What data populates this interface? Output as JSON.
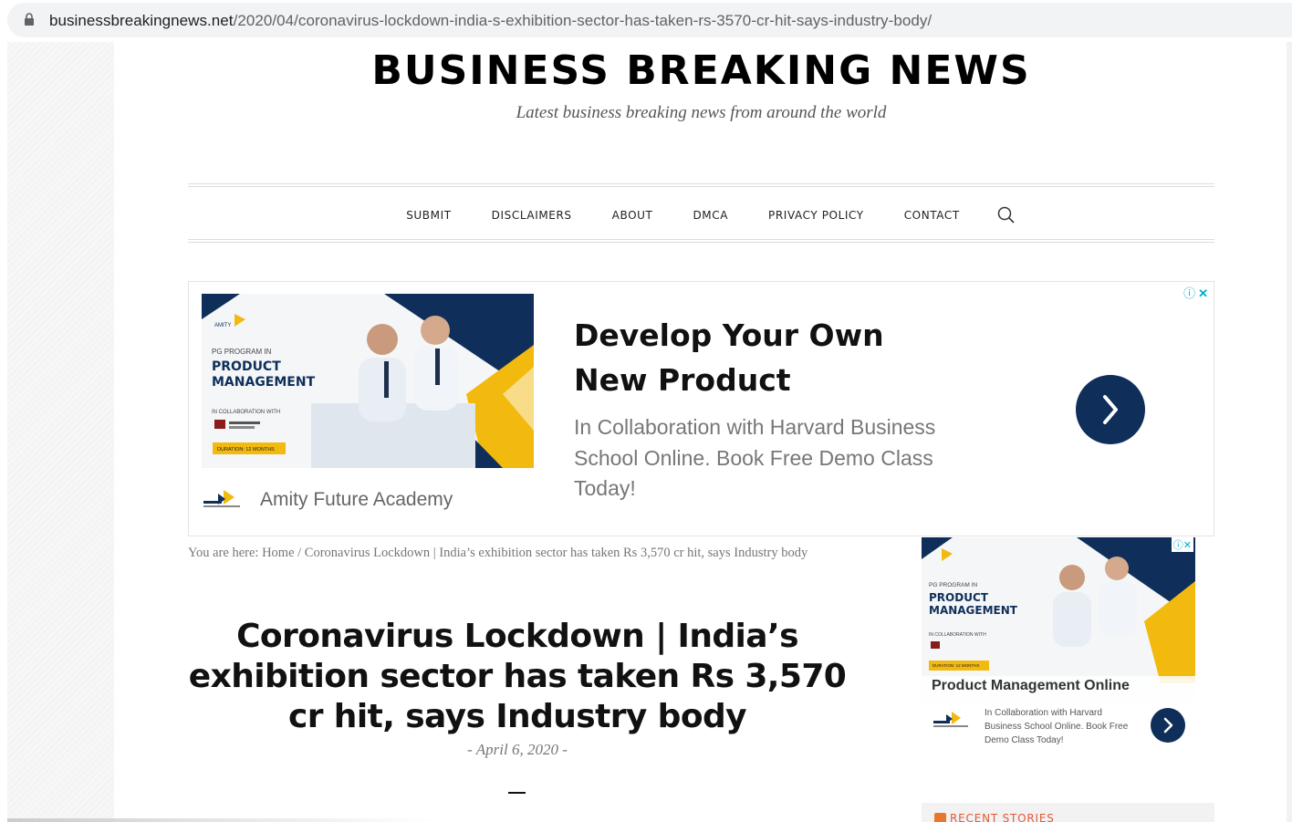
{
  "browser": {
    "url_domain": "businessbreakingnews.net",
    "url_path": "/2020/04/coronavirus-lockdown-india-s-exhibition-sector-has-taken-rs-3570-cr-hit-says-industry-body/"
  },
  "site": {
    "title": "BUSINESS BREAKING NEWS",
    "tagline": "Latest business breaking news from around the world"
  },
  "nav": {
    "items": [
      {
        "label": "SUBMIT"
      },
      {
        "label": "DISCLAIMERS"
      },
      {
        "label": "ABOUT"
      },
      {
        "label": "DMCA"
      },
      {
        "label": "PRIVACY POLICY"
      },
      {
        "label": "CONTACT"
      }
    ],
    "search_icon": "search-icon"
  },
  "ad_main": {
    "headline": "Develop Your Own New Product",
    "description": "In Collaboration with Harvard Business School Online. Book Free Demo Class Today!",
    "brand": "Amity Future Academy",
    "image": {
      "program_line": "PG PROGRAM IN",
      "program_name_1": "PRODUCT",
      "program_name_2": "MANAGEMENT",
      "collab": "IN COLLABORATION WITH",
      "duration": "DURATION: 12 MONTHS"
    },
    "colors": {
      "navy": "#0f2f5a",
      "gold": "#f2b90f"
    }
  },
  "breadcrumb": {
    "text": "You are here: Home / Coronavirus Lockdown | India’s exhibition sector has taken Rs 3,570 cr hit, says Industry body"
  },
  "article": {
    "title": "Coronavirus Lockdown | India’s exhibition sector has taken Rs 3,570 cr hit, says Industry body",
    "date": "- April 6, 2020 -"
  },
  "ad_side": {
    "headline": "Product Management Online",
    "description": "In Collaboration with Harvard Business School Online. Book Free Demo Class Today!",
    "image": {
      "program_line": "PG PROGRAM IN",
      "program_name_1": "PRODUCT",
      "program_name_2": "MANAGEMENT",
      "collab": "IN COLLABORATION WITH",
      "duration": "DURATION: 12 MONTHS"
    }
  },
  "sidebar": {
    "recent_stories_label": "RECENT STORIES"
  }
}
